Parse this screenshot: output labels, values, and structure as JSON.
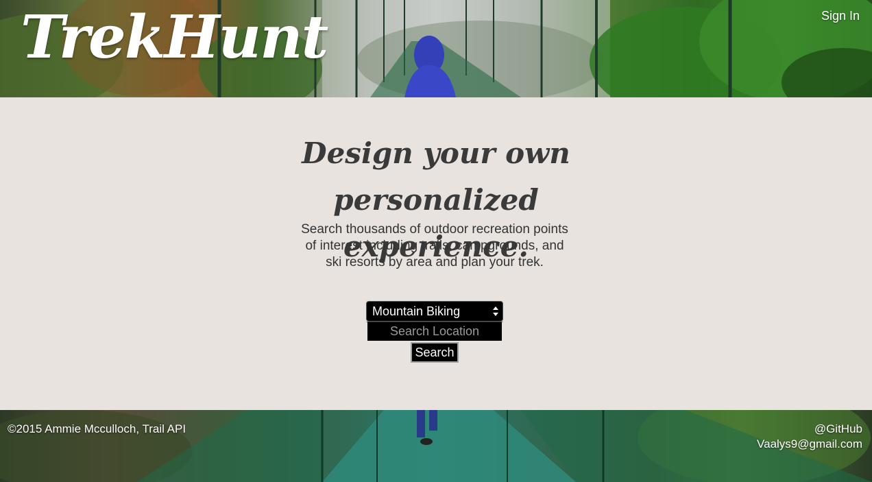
{
  "header": {
    "logo_text": "TrekHunt",
    "signin_label": "Sign In"
  },
  "hero": {
    "headline": "Design your own personalized experience.",
    "description": "Search thousands of outdoor recreation points of interest including trails, campgrounds, and ski resorts by area and plan your trek."
  },
  "search": {
    "activity_selected": "Mountain Biking",
    "location_placeholder": "Search Location",
    "location_value": "",
    "button_label": "Search"
  },
  "footer": {
    "copyright": "©2015 Ammie Mcculloch, Trail API",
    "github_label": "@GitHub",
    "email": "Vaalys9@gmail.com"
  },
  "colors": {
    "page_background": "#e8e3de",
    "headline_text": "#3a3a3a",
    "control_background": "#000000",
    "control_text": "#ffffff"
  },
  "icons": {
    "select_arrows": "updown-arrows-icon"
  }
}
